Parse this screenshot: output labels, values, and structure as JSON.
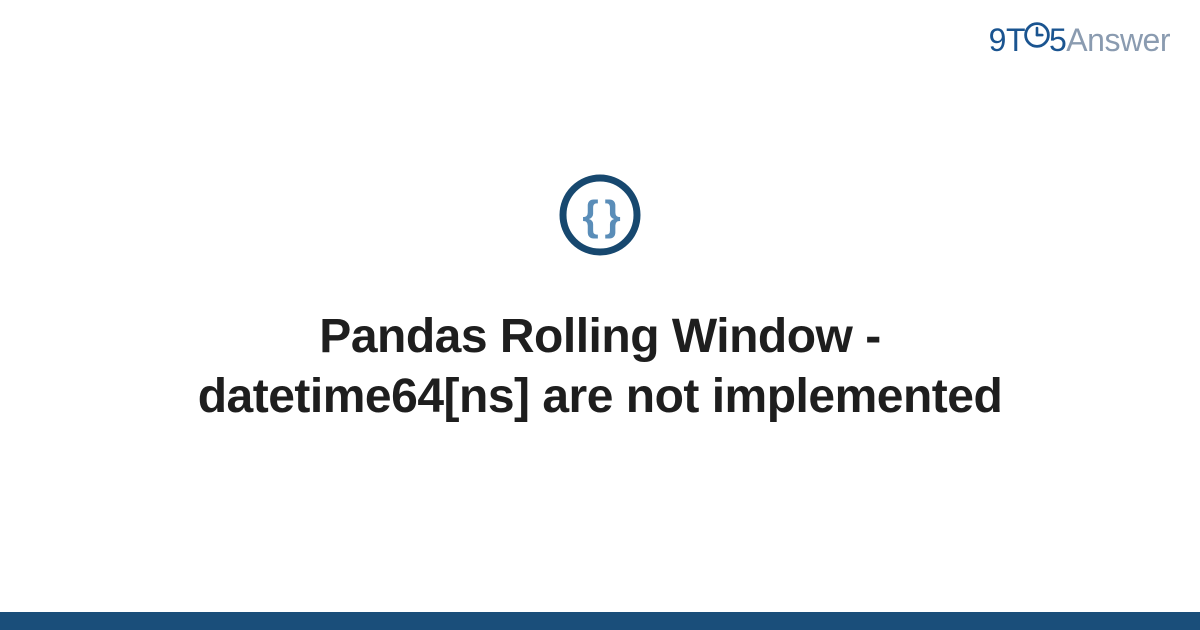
{
  "logo": {
    "part1": "9T",
    "part2": "5",
    "part3": "Answer"
  },
  "icon": {
    "name": "braces-icon"
  },
  "title": "Pandas Rolling Window - datetime64[ns] are not implemented",
  "colors": {
    "brand_dark": "#1a5490",
    "brand_light": "#5a8db8",
    "brand_grey": "#8a9bb0",
    "footer": "#1a4e7a",
    "text": "#1e1e1e"
  }
}
